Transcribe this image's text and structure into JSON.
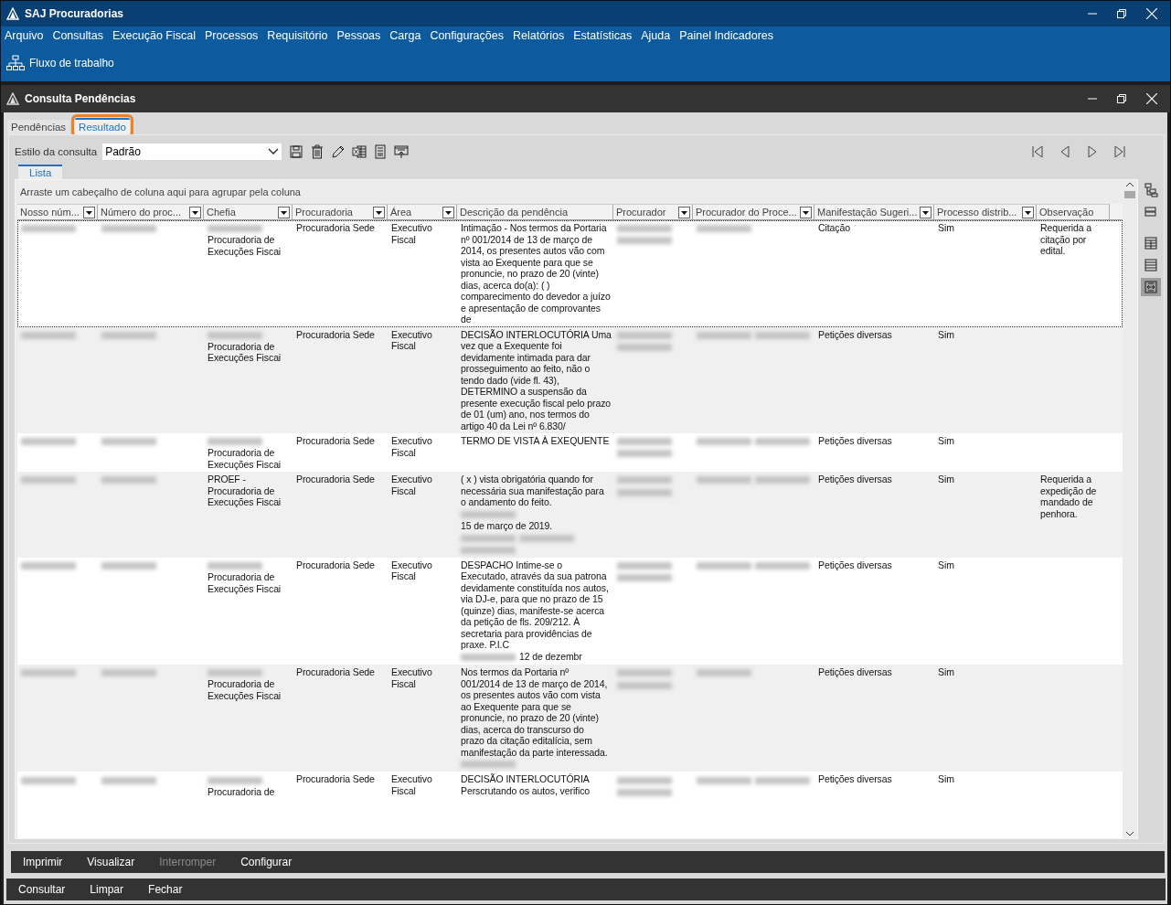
{
  "window": {
    "title": "SAJ Procuradorias"
  },
  "menu": [
    "Arquivo",
    "Consultas",
    "Execução Fiscal",
    "Processos",
    "Requisitório",
    "Pessoas",
    "Carga",
    "Configurações",
    "Relatórios",
    "Estatísticas",
    "Ajuda",
    "Painel Indicadores"
  ],
  "toolbar": {
    "workflow_label": "Fluxo de trabalho"
  },
  "child_window": {
    "title": "Consulta Pendências"
  },
  "tabs": [
    {
      "label": "Pendências",
      "selected": false,
      "highlighted": false
    },
    {
      "label": "Resultado",
      "selected": true,
      "highlighted": true
    }
  ],
  "query_style": {
    "label": "Estilo da consulta",
    "value": "Padrão"
  },
  "subtabs": [
    {
      "label": "Lista",
      "selected": true
    }
  ],
  "side_tools": [
    {
      "kind": "tree",
      "selected": false
    },
    {
      "kind": "group",
      "selected": false
    },
    {
      "kind": "table",
      "selected": false
    },
    {
      "kind": "list",
      "selected": false
    },
    {
      "kind": "fit",
      "selected": true
    }
  ],
  "grid": {
    "group_hint": "Arraste um cabeçalho de coluna aqui para agrupar pela coluna",
    "columns": [
      {
        "label": "Nosso núm...",
        "filter": true
      },
      {
        "label": "Número do proc...",
        "filter": true
      },
      {
        "label": "Chefia",
        "filter": true
      },
      {
        "label": "Procuradoria",
        "filter": true
      },
      {
        "label": "Área",
        "filter": true
      },
      {
        "label": "Descrição da pendência",
        "filter": false
      },
      {
        "label": "Procurador",
        "filter": true
      },
      {
        "label": "Procurador do Proce...",
        "filter": true
      },
      {
        "label": "Manifestação Sugeri...",
        "filter": true
      },
      {
        "label": "Processo distrib...",
        "filter": true
      },
      {
        "label": "Observação",
        "filter": false
      }
    ],
    "rows": [
      {
        "selected": true,
        "cells": [
          [
            {
              "redacted": true
            }
          ],
          [
            {
              "redacted": true
            }
          ],
          [
            {
              "redacted": true
            },
            "Procuradoria de Execuções Fiscai"
          ],
          "Procuradoria Sede",
          "Executivo Fiscal",
          "Intimação - Nos termos da Portaria nº 001/2014 de 13 de março de 2014, os presentes autos vão com vista ao Exequente para que se pronuncie, no prazo de 20 (vinte) dias, acerca do(a): ( ) comparecimento do devedor a juízo e apresentação de comprovantes de",
          [
            {
              "redacted": true
            },
            {
              "redacted": true
            }
          ],
          [
            {
              "redacted": true
            }
          ],
          "Citação",
          "Sim",
          "Requerida a citação por edital."
        ]
      },
      {
        "selected": false,
        "cells": [
          [
            {
              "redacted": true
            }
          ],
          [
            {
              "redacted": true
            }
          ],
          [
            {
              "redacted": true
            },
            "Procuradoria de Execuções Fiscai"
          ],
          "Procuradoria Sede",
          "Executivo Fiscal",
          "DECISÃO INTERLOCUTÓRIA Uma vez que a Exequente foi devidamente intimada para dar prosseguimento ao feito, não o tendo dado (vide fl. 43), DETERMINO a suspensão da presente execução fiscal pelo prazo de 01 (um) ano, nos termos do artigo 40 da Lei nº 6.830/",
          [
            {
              "redacted": true
            },
            {
              "redacted": true
            }
          ],
          [
            {
              "redacted": true
            },
            {
              "redacted": true
            }
          ],
          "Petições diversas",
          "Sim",
          null
        ]
      },
      {
        "selected": false,
        "cells": [
          [
            {
              "redacted": true
            }
          ],
          [
            {
              "redacted": true
            }
          ],
          [
            {
              "redacted": true
            },
            "Procuradoria de Execuções Fiscai"
          ],
          "Procuradoria Sede",
          "Executivo Fiscal",
          "TERMO DE VISTA À EXEQUENTE",
          [
            {
              "redacted": true
            },
            {
              "redacted": true
            }
          ],
          [
            {
              "redacted": true
            },
            {
              "redacted": true
            }
          ],
          "Petições diversas",
          "Sim",
          null
        ]
      },
      {
        "selected": false,
        "cells": [
          [
            {
              "redacted": true
            }
          ],
          [
            {
              "redacted": true
            }
          ],
          "PROEF - Procuradoria de Execuções Fiscai",
          "Procuradoria Sede",
          "Executivo Fiscal",
          [
            "( x ) vista obrigatória quando for necessária sua manifestação para o andamento do feito.",
            {
              "redacted": true
            },
            "15 de março de 2019.",
            {
              "redacted": true
            },
            {
              "redacted": true
            },
            {
              "redacted": true
            }
          ],
          [
            {
              "redacted": true
            },
            {
              "redacted": true
            }
          ],
          [
            {
              "redacted": true
            },
            {
              "redacted": true
            }
          ],
          "Petições diversas",
          "Sim",
          "Requerida a expedição de mandado de penhora."
        ]
      },
      {
        "selected": false,
        "cells": [
          [
            {
              "redacted": true
            }
          ],
          [
            {
              "redacted": true
            }
          ],
          [
            {
              "redacted": true
            },
            "Procuradoria de Execuções Fiscai"
          ],
          "Procuradoria Sede",
          "Executivo Fiscal",
          [
            "DESPACHO Intime-se o Executado, através da sua patrona devidamente constituída nos autos, via DJ-e, para que no prazo de 15 (quinze) dias, manifeste-se acerca da petição de fls. 209/212. À secretaria para providências de praxe. P.I.C",
            {
              "redacted": true
            },
            "12 de dezembr"
          ],
          [
            {
              "redacted": true
            },
            {
              "redacted": true
            }
          ],
          [
            {
              "redacted": true
            },
            {
              "redacted": true
            }
          ],
          "Petições diversas",
          "Sim",
          null
        ]
      },
      {
        "selected": false,
        "cells": [
          [
            {
              "redacted": true
            }
          ],
          [
            {
              "redacted": true
            }
          ],
          [
            {
              "redacted": true
            },
            "Procuradoria de Execuções Fiscai"
          ],
          "Procuradoria Sede",
          "Executivo Fiscal",
          [
            "Nos termos da Portaria nº 001/2014 de 13 de março de 2014, os presentes autos vão com vista ao Exequente para que se pronuncie, no prazo de 20 (vinte) dias, acerca do transcurso do prazo da citação editalícia, sem manifestação da parte interessada.",
            {
              "redacted": true
            }
          ],
          [
            {
              "redacted": true
            },
            {
              "redacted": true
            }
          ],
          [
            {
              "redacted": true
            }
          ],
          "Petições diversas",
          "Sim",
          null
        ]
      },
      {
        "selected": false,
        "cells": [
          [
            {
              "redacted": true
            }
          ],
          [
            {
              "redacted": true
            }
          ],
          [
            {
              "redacted": true
            },
            "Procuradoria de"
          ],
          "Procuradoria Sede",
          "Executivo Fiscal",
          "DECISÃO INTERLOCUTÓRIA Perscrutando os autos, verifico",
          [
            {
              "redacted": true
            },
            {
              "redacted": true
            }
          ],
          [
            {
              "redacted": true
            },
            {
              "redacted": true
            }
          ],
          "Petições diversas",
          "Sim",
          null
        ]
      }
    ]
  },
  "actions": [
    {
      "label": "Imprimir",
      "disabled": false
    },
    {
      "label": "Visualizar",
      "disabled": false
    },
    {
      "label": "Interromper",
      "disabled": true
    },
    {
      "label": "Configurar",
      "disabled": false
    }
  ],
  "footer_buttons": [
    {
      "label": "Consultar",
      "disabled": false
    },
    {
      "label": "Limpar",
      "disabled": false
    },
    {
      "label": "Fechar",
      "disabled": false
    }
  ]
}
